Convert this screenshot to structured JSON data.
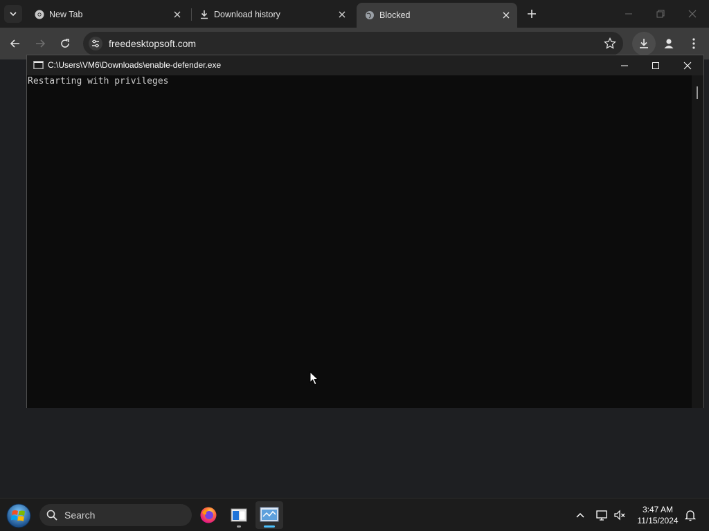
{
  "browser": {
    "tabs": [
      {
        "title": "New Tab",
        "icon": "chrome-icon",
        "active": false
      },
      {
        "title": "Download history",
        "icon": "download-icon",
        "active": false
      },
      {
        "title": "Blocked",
        "icon": "globe-icon",
        "active": true
      }
    ],
    "url": "freedesktopsoft.com"
  },
  "console": {
    "title": "C:\\Users\\VM6\\Downloads\\enable-defender.exe",
    "output": "Restarting with privileges"
  },
  "taskbar": {
    "search_placeholder": "Search",
    "apps": [
      "firefox-icon",
      "file-explorer-icon",
      "control-panel-icon"
    ],
    "clock_time": "3:47 AM",
    "clock_date": "11/15/2024"
  },
  "colors": {
    "chrome_dark": "#1f1f1f",
    "toolbar": "#3c3c3c",
    "console_bg": "#0c0c0c",
    "console_text": "#cccccc",
    "taskbar_accent": "#4cc2ff"
  }
}
